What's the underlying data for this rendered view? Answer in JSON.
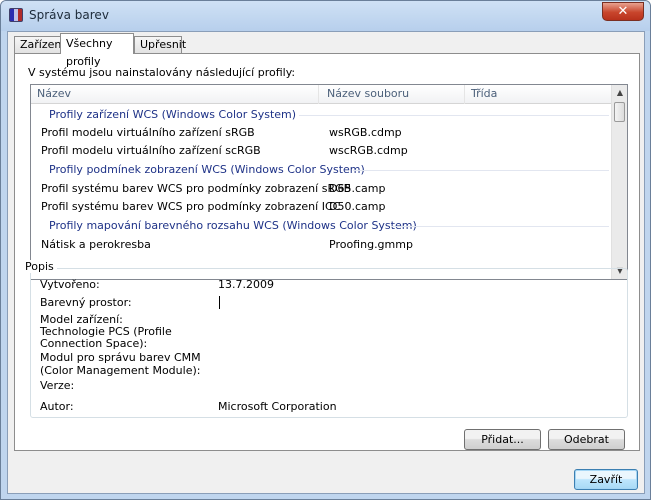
{
  "window": {
    "title": "Správa barev",
    "close_symbol": "✕"
  },
  "tabs": [
    {
      "label": "Zařízení"
    },
    {
      "label": "Všechny profily"
    },
    {
      "label": "Upřesnit"
    }
  ],
  "intro_text": "V systému jsou nainstalovány následující profily:",
  "list": {
    "columns": [
      "Název",
      "Název souboru",
      "Třída"
    ],
    "groups": [
      {
        "title": "Profily zařízení WCS (Windows Color System)",
        "rows": [
          {
            "name": "Profil modelu virtuálního zařízení sRGB",
            "file": "wsRGB.cdmp",
            "class": ""
          },
          {
            "name": "Profil modelu virtuálního zařízení scRGB",
            "file": "wscRGB.cdmp",
            "class": ""
          }
        ]
      },
      {
        "title": "Profily podmínek zobrazení WCS (Windows Color System)",
        "rows": [
          {
            "name": "Profil systému barev WCS pro podmínky zobrazení sRGB",
            "file": "D65.camp",
            "class": ""
          },
          {
            "name": "Profil systému barev WCS pro podmínky zobrazení ICC",
            "file": "D50.camp",
            "class": ""
          }
        ]
      },
      {
        "title": "Profily mapování barevného rozsahu WCS (Windows Color System)",
        "rows": [
          {
            "name": "Nátisk a perokresba",
            "file": "Proofing.gmmp",
            "class": ""
          }
        ]
      }
    ],
    "scroll_up": "▲",
    "scroll_down": "▼"
  },
  "description": {
    "legend": "Popis",
    "created_label": "Vytvořeno:",
    "created_value": "13.7.2009",
    "color_space_label": "Barevný prostor:",
    "color_space_value": "",
    "device_model_label": "Model zařízení:",
    "pcs_label_1": "Technologie PCS (Profile",
    "pcs_label_2": "Connection Space):",
    "cmm_label_1": "Modul pro správu barev CMM",
    "cmm_label_2": "(Color Management Module):",
    "version_label": "Verze:",
    "author_label": "Autor:",
    "author_value": "Microsoft Corporation"
  },
  "buttons": {
    "add": "Přidat...",
    "remove": "Odebrat",
    "close": "Zavřít"
  }
}
